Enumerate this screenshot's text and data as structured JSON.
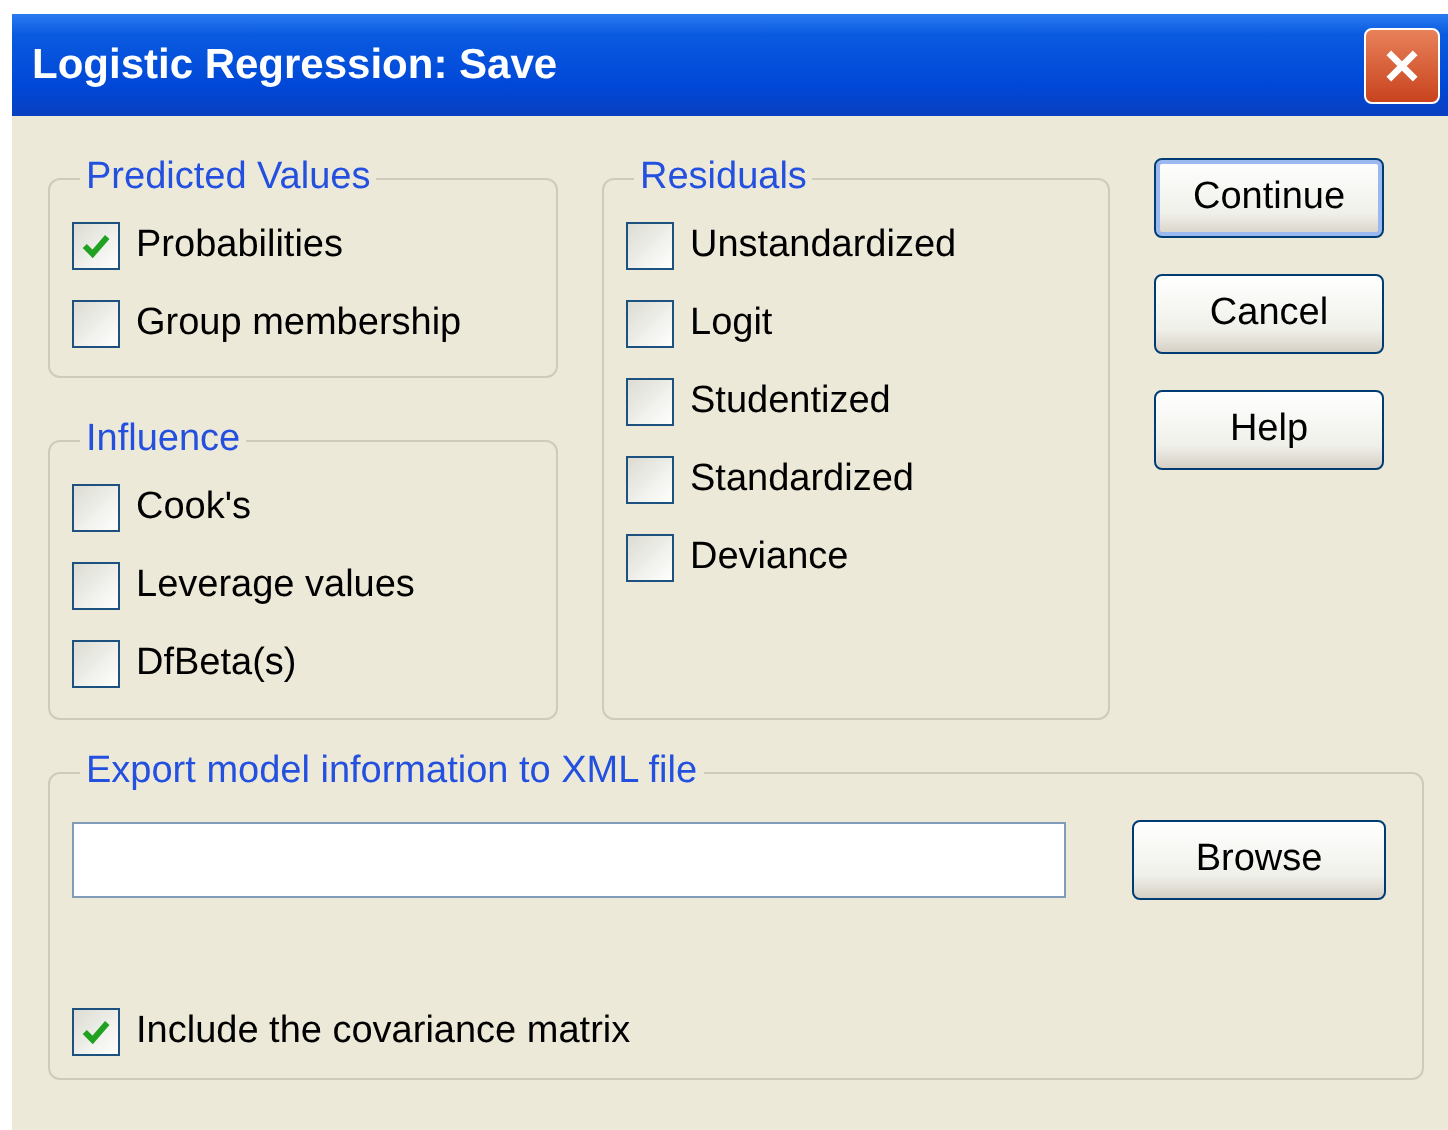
{
  "window": {
    "title": "Logistic Regression: Save"
  },
  "groups": [
    {
      "title": "Predicted Values",
      "options": [
        {
          "label": "Probabilities",
          "checked": true
        },
        {
          "label": "Group membership",
          "checked": false
        }
      ]
    },
    {
      "title": "Influence",
      "options": [
        {
          "label": "Cook's",
          "checked": false
        },
        {
          "label": "Leverage values",
          "checked": false
        },
        {
          "label": "DfBeta(s)",
          "checked": false
        }
      ]
    },
    {
      "title": "Residuals",
      "options": [
        {
          "label": "Unstandardized",
          "checked": false
        },
        {
          "label": "Logit",
          "checked": false
        },
        {
          "label": "Studentized",
          "checked": false
        },
        {
          "label": "Standardized",
          "checked": false
        },
        {
          "label": "Deviance",
          "checked": false
        }
      ]
    }
  ],
  "buttons": [
    {
      "label": "Continue",
      "default": true
    },
    {
      "label": "Cancel",
      "default": false
    },
    {
      "label": "Help",
      "default": false
    }
  ],
  "export": {
    "title": "Export model information to XML file",
    "browse": "Browse",
    "covariance": {
      "label": "Include the covariance matrix",
      "checked": true
    }
  }
}
